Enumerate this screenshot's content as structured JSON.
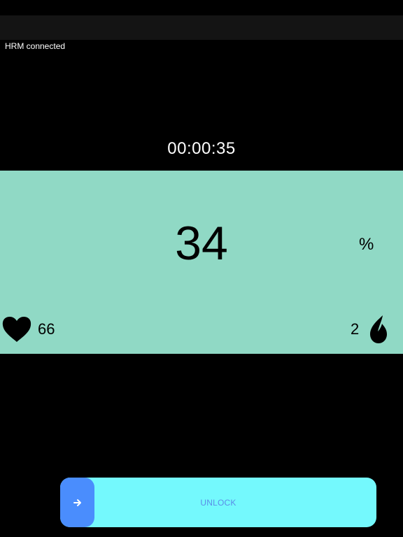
{
  "status": {
    "connection_text": "HRM connected"
  },
  "timer": {
    "elapsed": "00:00:35"
  },
  "metrics": {
    "main_value": "34",
    "unit": "%",
    "heart_rate": "66",
    "drop_count": "2",
    "panel_color": "#90d9c5"
  },
  "icons": {
    "heart": "heart-icon",
    "drop": "drop-icon",
    "arrow": "arrow-right-icon"
  },
  "unlock": {
    "label": "UNLOCK",
    "track_color": "#74f9fd",
    "handle_color": "#4a8dfd",
    "progress": 0
  }
}
